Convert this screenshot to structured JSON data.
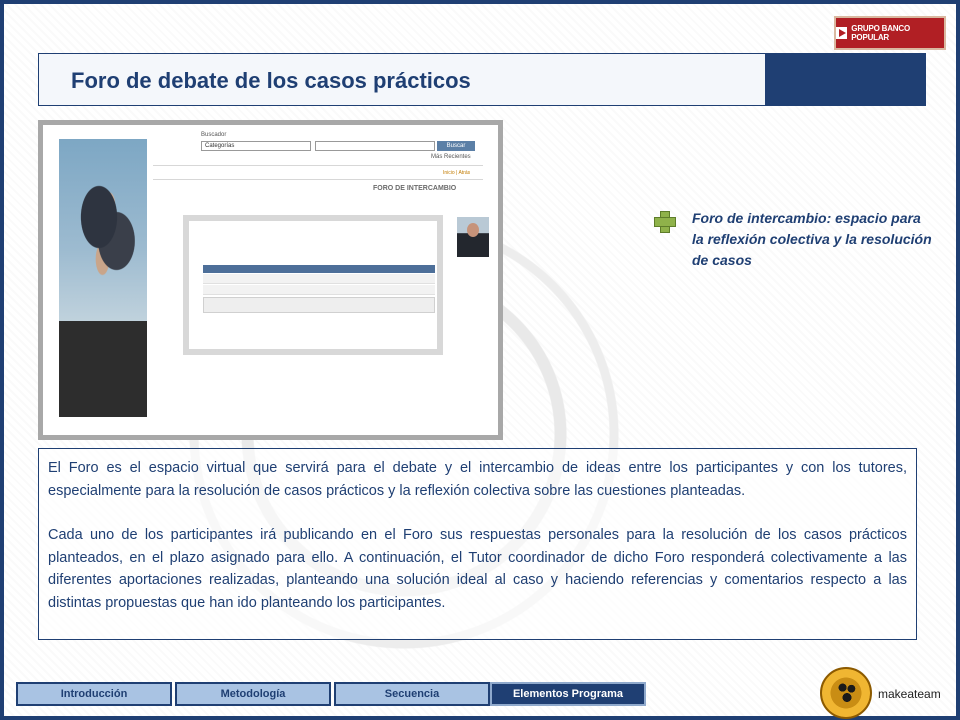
{
  "brand": {
    "logo_text": "GRUPO BANCO POPULAR"
  },
  "header": {
    "title": "Foro de debate de los casos prácticos"
  },
  "screenshot": {
    "search_label": "Buscador",
    "category_select": "Categorías",
    "search_button": "Buscar",
    "recent_link": "Más Recientes",
    "links": "Inicio | Atrás",
    "heading": "FORO DE INTERCAMBIO"
  },
  "callout": {
    "text": "Foro de intercambio: espacio para la reflexión colectiva y la resolución de casos"
  },
  "description": {
    "paragraph1": "El Foro es el espacio virtual que servirá para el debate y el intercambio de ideas entre los participantes y con los tutores, especialmente para la resolución de casos prácticos y la reflexión colectiva sobre las cuestiones planteadas.",
    "paragraph2": "Cada uno de los participantes irá publicando en el Foro sus respuestas personales para la resolución de los casos prácticos planteados, en el plazo asignado para ello. A continuación, el Tutor coordinador de dicho Foro responderá colectivamente a las diferentes aportaciones realizadas, planteando una solución ideal al caso y haciendo referencias y comentarios respecto a las distintas propuestas que han ido planteando los participantes."
  },
  "nav": {
    "tabs": [
      {
        "label": "Introducción",
        "active": false
      },
      {
        "label": "Metodología",
        "active": false
      },
      {
        "label": "Secuencia",
        "active": false
      },
      {
        "label": "Elementos Programa",
        "active": true
      }
    ]
  },
  "footer": {
    "logo_text": "makeateam"
  },
  "colors": {
    "primary": "#1f3f73",
    "tab_inactive": "#a9c3e3",
    "brand_red": "#b11f24",
    "plus_green": "#8fb24a"
  }
}
